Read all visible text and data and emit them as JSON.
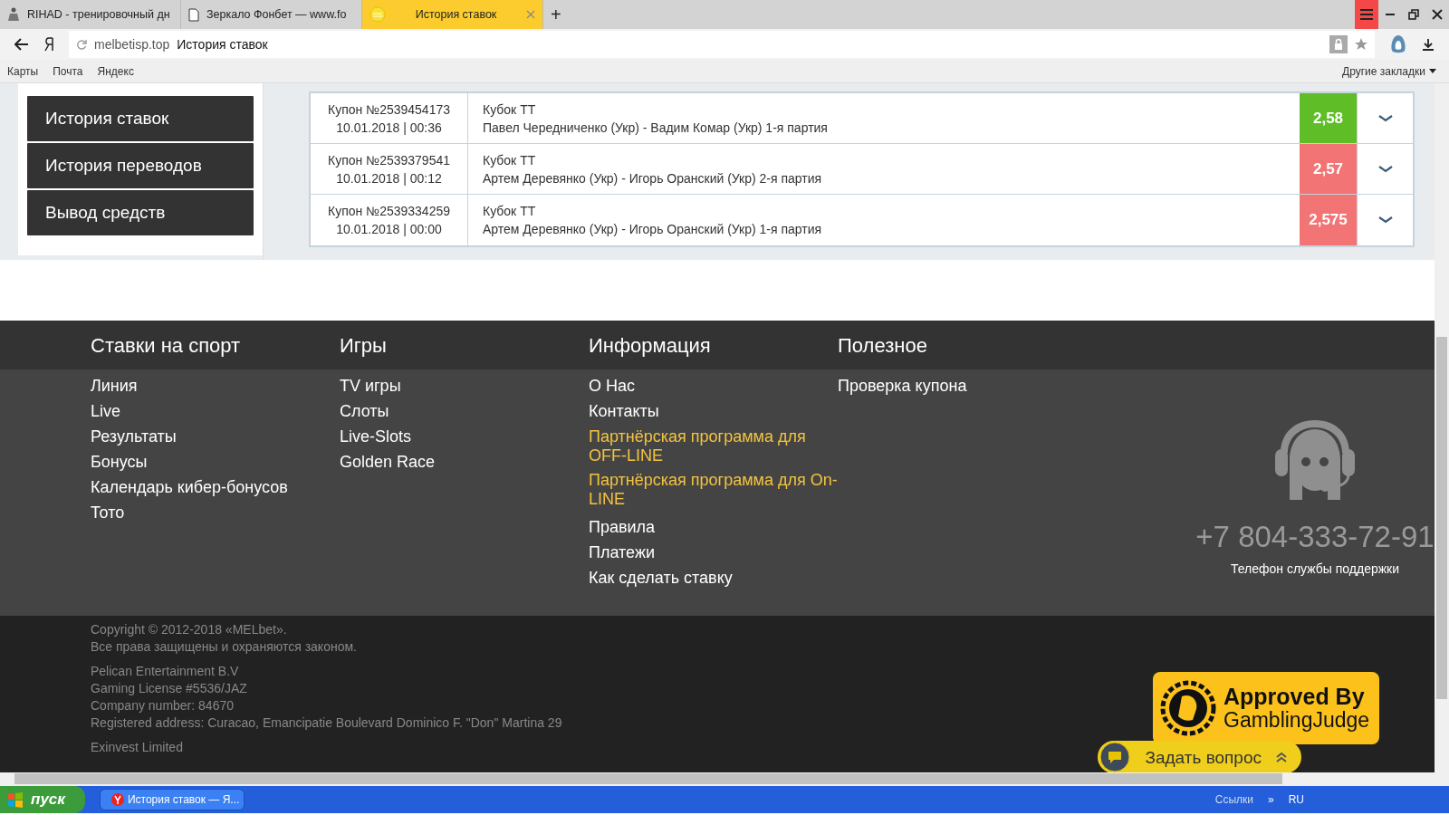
{
  "browser": {
    "tabs": [
      {
        "title": "RIHAD - тренировочный дн",
        "selected": false,
        "kind": "figure"
      },
      {
        "title": "Зеркало Фонбет — www.fo",
        "selected": false,
        "kind": "page"
      },
      {
        "title": "История ставок",
        "selected": true,
        "kind": "coin"
      }
    ],
    "new_tab": "+",
    "address": {
      "domain": "melbetisp.top",
      "title": "История ставок"
    },
    "bookmarks": [
      "Карты",
      "Почта",
      "Яндекс"
    ],
    "other_bookmarks": "Другие закладки"
  },
  "sidebar": {
    "items": [
      "История ставок",
      "История переводов",
      "Вывод средств"
    ]
  },
  "bets": [
    {
      "coupon": "Купон №2539454173",
      "date": "10.01.2018 | 00:36",
      "tournament": "Кубок ТТ",
      "event": "Павел Чередниченко (Укр) - Вадим Комар (Укр) 1-я партия",
      "odds": "2,58",
      "color": "#5fbe28"
    },
    {
      "coupon": "Купон №2539379541",
      "date": "10.01.2018 | 00:12",
      "tournament": "Кубок ТТ",
      "event": "Артем Деревянко (Укр) - Игорь Оранский (Укр) 2-я партия",
      "odds": "2,57",
      "color": "#f27474"
    },
    {
      "coupon": "Купон №2539334259",
      "date": "10.01.2018 | 00:00",
      "tournament": "Кубок ТТ",
      "event": "Артем Деревянко (Укр) - Игорь Оранский (Укр) 1-я партия",
      "odds": "2,575",
      "color": "#f27474"
    }
  ],
  "footer": {
    "columns": [
      {
        "heading": "Ставки на спорт",
        "links": [
          {
            "text": "Линия",
            "highlighted": false
          },
          {
            "text": "Live",
            "highlighted": false
          },
          {
            "text": "Результаты",
            "highlighted": false
          },
          {
            "text": "Бонусы",
            "highlighted": false
          },
          {
            "text": "Календарь кибер-бонусов",
            "highlighted": false
          },
          {
            "text": "Тото",
            "highlighted": false
          }
        ]
      },
      {
        "heading": "Игры",
        "links": [
          {
            "text": "TV игры",
            "highlighted": false
          },
          {
            "text": "Слоты",
            "highlighted": false
          },
          {
            "text": "Live-Slots",
            "highlighted": false
          },
          {
            "text": "Golden Race",
            "highlighted": false
          }
        ]
      },
      {
        "heading": "Информация",
        "links": [
          {
            "text": "О Нас",
            "highlighted": false
          },
          {
            "text": "Контакты",
            "highlighted": false
          },
          {
            "text": "Партнёрская программа для OFF-LINE",
            "highlighted": true
          },
          {
            "text": "Партнёрская программа для On-LINE",
            "highlighted": true
          },
          {
            "text": "Правила",
            "highlighted": false
          },
          {
            "text": "Платежи",
            "highlighted": false
          },
          {
            "text": "Как сделать ставку",
            "highlighted": false
          }
        ]
      },
      {
        "heading": "Полезное",
        "links": [
          {
            "text": "Проверка купона",
            "highlighted": false
          }
        ]
      }
    ],
    "phone": "+7 804-333-72-91",
    "phone_caption": "Телефон службы поддержки",
    "legal": [
      [
        "Copyright © 2012-2018 «MELbet».",
        "Все права защищены и охраняются законом."
      ],
      [
        "Pelican Entertainment B.V",
        "Gaming License #5536/JAZ",
        "Company number: 84670",
        "Registered address: Curacao, Emancipatie Boulevard Dominico F. \"Don\" Martina 29"
      ],
      [
        "Exinvest Limited"
      ]
    ],
    "badge": {
      "line_1": "Approved By",
      "line_2": "GamblingJudge"
    },
    "chat_button": "Задать вопрос"
  },
  "taskbar": {
    "start": "пуск",
    "task": "История ставок — Я...",
    "links": "Ссылки",
    "links_more": "»",
    "language": "RU"
  }
}
